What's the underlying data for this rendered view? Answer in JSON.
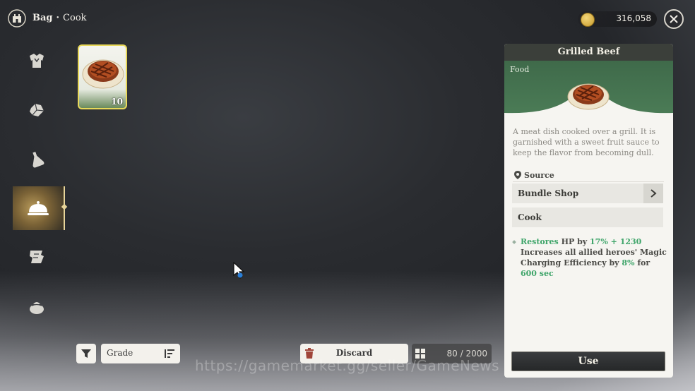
{
  "header": {
    "section": "Bag",
    "separator": "·",
    "subsection": "Cook",
    "logo_icon": "castle-crest-icon"
  },
  "currency": {
    "icon": "gold-coin-icon",
    "amount": "316,058"
  },
  "close": {
    "icon": "close-icon"
  },
  "sidebar": {
    "items": [
      {
        "icon": "armor-icon",
        "active": false
      },
      {
        "icon": "gem-icon",
        "active": false
      },
      {
        "icon": "potion-icon",
        "active": false
      },
      {
        "icon": "cloche-icon",
        "active": true
      },
      {
        "icon": "scroll-icon",
        "active": false
      },
      {
        "icon": "pouch-icon",
        "active": false
      }
    ]
  },
  "inventory": {
    "items": [
      {
        "name": "Grilled Beef",
        "icon": "grilled-beef-icon",
        "quantity": "10",
        "selected": true
      }
    ]
  },
  "controls": {
    "filter_icon": "filter-icon",
    "sort_label": "Grade",
    "sort_icon": "sort-icon",
    "discard_label": "Discard",
    "discard_icon": "trash-icon",
    "capacity": "80 / 2000",
    "capacity_icon": "grid-icon"
  },
  "detail": {
    "title": "Grilled Beef",
    "category": "Food",
    "description": "A meat dish cooked over a grill. It is garnished with a sweet fruit sauce to keep the flavor from becoming dull.",
    "source_label": "Source",
    "sources": [
      {
        "label": "Bundle Shop",
        "has_link": true
      },
      {
        "label": "Cook",
        "has_link": false
      }
    ],
    "effect": {
      "restores": "Restores",
      "stat": "HP by",
      "percent": "17%",
      "plus": "+",
      "flat": "1230",
      "line2": "Increases all allied heroes' Magic",
      "line3_a": "Charging Efficiency by",
      "line3_pct": "8%",
      "line3_for": "for",
      "duration": "600 sec"
    },
    "use_label": "Use"
  },
  "watermark": "https://gamemarket.gg/seller/GameNews"
}
